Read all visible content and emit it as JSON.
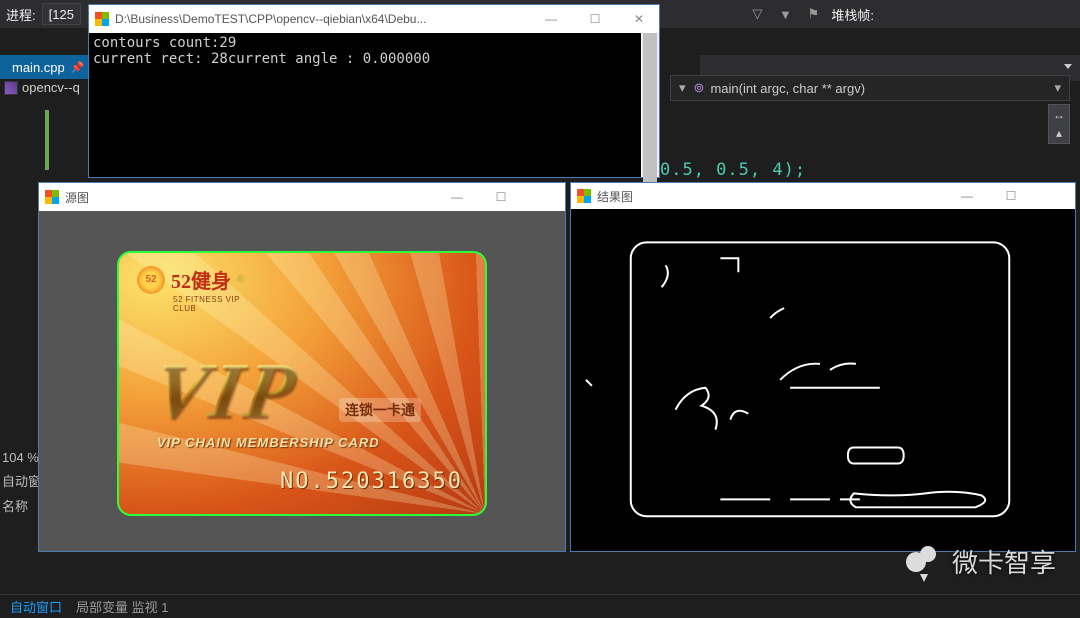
{
  "toolbar": {
    "process_label": "进程:",
    "process_value": "[125",
    "stack_label": "堆栈帧:"
  },
  "tabs": {
    "main": "main.cpp",
    "project": "opencv--q"
  },
  "nav": {
    "fn_sig": "main(int argc, char ** argv)"
  },
  "code_snip": "0.5, 0.5, 4);",
  "status": {
    "zoom": "104 %",
    "auto1": "自动窗",
    "auto2": "名称"
  },
  "bottom": {
    "active": "自动窗口",
    "rest": "局部变量   监视 1"
  },
  "console": {
    "title": "D:\\Business\\DemoTEST\\CPP\\opencv--qiebian\\x64\\Debu...",
    "line1": "contours count:29",
    "line2": "current rect: 28current angle : 0.000000"
  },
  "srcwin": {
    "title": "源图",
    "brand_logo": "52",
    "brand_text": "52健身",
    "brand_reg": "®",
    "brand_sub": "52 FITNESS VIP CLUB",
    "vip": "VIP",
    "vip_side": "连锁一卡通",
    "vip_sub": "VIP CHAIN MEMBERSHIP CARD",
    "cardno": "NO.520316350"
  },
  "reswin": {
    "title": "结果图"
  },
  "watermark": "微卡智享"
}
